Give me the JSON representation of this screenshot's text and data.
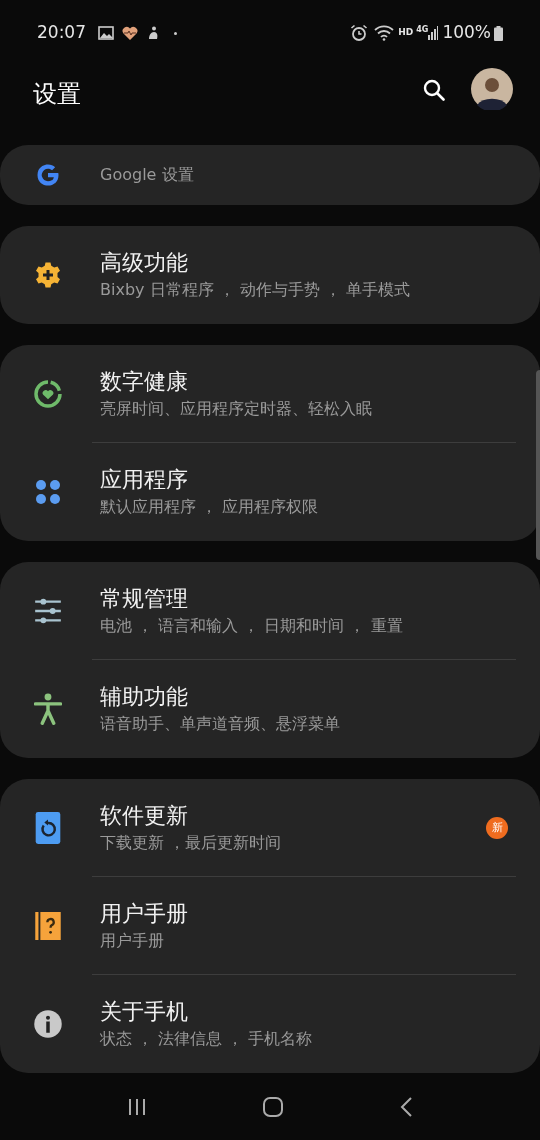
{
  "status_bar": {
    "time": "20:07",
    "hd": "HD",
    "network": "4G",
    "battery": "100%"
  },
  "header": {
    "title": "设置"
  },
  "groups": [
    {
      "items": [
        {
          "kind": "google",
          "subtitle": "Google 设置"
        }
      ]
    },
    {
      "items": [
        {
          "kind": "advanced",
          "title": "高级功能",
          "subtitle": "Bixby 日常程序 ， 动作与手势 ， 单手模式"
        }
      ]
    },
    {
      "items": [
        {
          "kind": "wellbeing",
          "title": "数字健康",
          "subtitle": "亮屏时间、应用程序定时器、轻松入眠"
        },
        {
          "kind": "apps",
          "title": "应用程序",
          "subtitle": "默认应用程序 ， 应用程序权限"
        }
      ]
    },
    {
      "items": [
        {
          "kind": "general",
          "title": "常规管理",
          "subtitle": "电池 ， 语言和输入 ， 日期和时间 ， 重置"
        },
        {
          "kind": "accessibility",
          "title": "辅助功能",
          "subtitle": "语音助手、单声道音频、悬浮菜单"
        }
      ]
    },
    {
      "items": [
        {
          "kind": "update",
          "title": "软件更新",
          "subtitle": "下载更新 ，最后更新时间",
          "badge": "新"
        },
        {
          "kind": "manual",
          "title": "用户手册",
          "subtitle": "用户手册"
        },
        {
          "kind": "about",
          "title": "关于手机",
          "subtitle": "状态 ， 法律信息 ， 手机名称"
        }
      ]
    }
  ]
}
